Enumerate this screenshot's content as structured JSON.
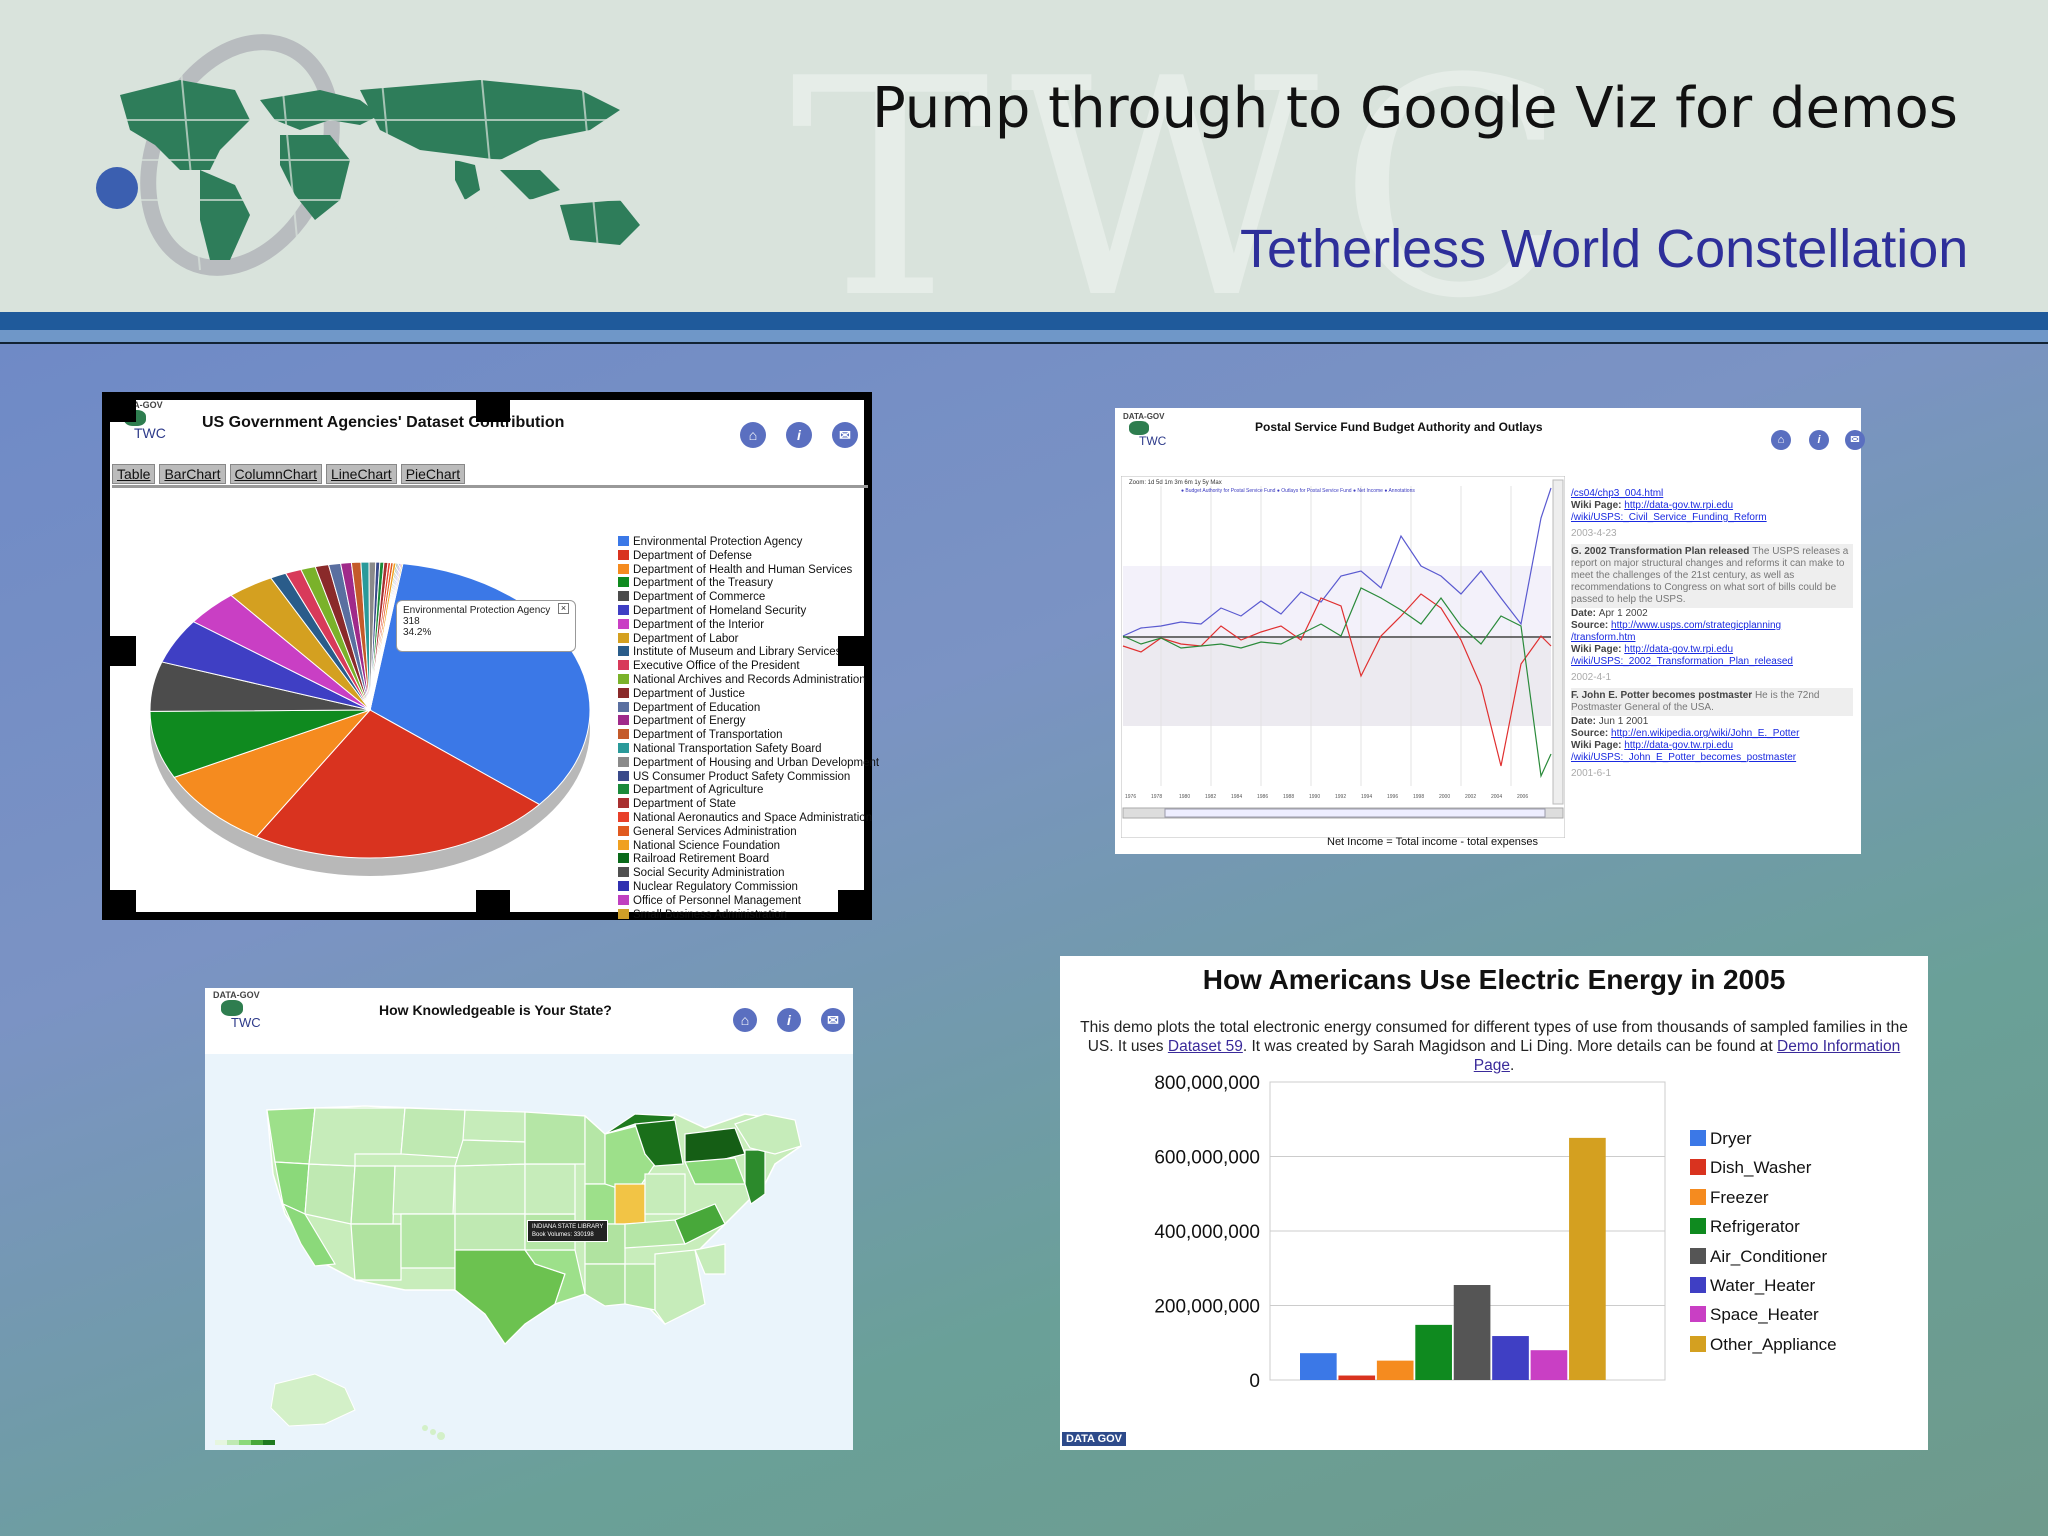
{
  "slide": {
    "title": "Pump through to Google Viz for demos",
    "subtitle": "Tetherless World Constellation",
    "watermark": "TWC"
  },
  "colors": {
    "header_bg": "#d9e3dc",
    "title_blue": "#2e2f9a",
    "bar_blue": "#1f5a9b",
    "map_green": "#2e7d4f"
  },
  "pie_panel": {
    "logo_top": "DATA-GOV",
    "logo_bottom": "TWC",
    "title": "US Government Agencies' Dataset Contribution",
    "tabs": [
      "Table",
      "BarChart",
      "ColumnChart",
      "LineChart",
      "PieChart"
    ],
    "tooltip": {
      "name": "Environmental Protection Agency",
      "value": "318",
      "percent": "34.2%"
    },
    "legend": [
      {
        "label": "Environmental Protection Agency",
        "color": "#3b78e7"
      },
      {
        "label": "Department of Defense",
        "color": "#d9331f"
      },
      {
        "label": "Department of Health and Human Services",
        "color": "#f58b1f"
      },
      {
        "label": "Department of the Treasury",
        "color": "#0f8a1f"
      },
      {
        "label": "Department of Commerce",
        "color": "#4c4c4c"
      },
      {
        "label": "Department of Homeland Security",
        "color": "#3f3fc4"
      },
      {
        "label": "Department of the Interior",
        "color": "#c93fc4"
      },
      {
        "label": "Department of Labor",
        "color": "#d4a020"
      },
      {
        "label": "Institute of Museum and Library Services",
        "color": "#2a5c8a"
      },
      {
        "label": "Executive Office of the President",
        "color": "#d83a5a"
      },
      {
        "label": "National Archives and Records Administration",
        "color": "#7ab22a"
      },
      {
        "label": "Department of Justice",
        "color": "#8a2a2a"
      },
      {
        "label": "Department of Education",
        "color": "#5a6fa0"
      },
      {
        "label": "Department of Energy",
        "color": "#a02a8a"
      },
      {
        "label": "Department of Transportation",
        "color": "#c45a2a"
      },
      {
        "label": "National Transportation Safety Board",
        "color": "#2a9a9a"
      },
      {
        "label": "Department of Housing and Urban Development",
        "color": "#8a8a8a"
      },
      {
        "label": "US Consumer Product Safety Commission",
        "color": "#3a4a8a"
      },
      {
        "label": "Department of Agriculture",
        "color": "#1a8a3a"
      },
      {
        "label": "Department of State",
        "color": "#a83030"
      },
      {
        "label": "National Aeronautics and Space Administration",
        "color": "#e8402a"
      },
      {
        "label": "General Services Administration",
        "color": "#e05a20"
      },
      {
        "label": "National Science Foundation",
        "color": "#f0a020"
      },
      {
        "label": "Railroad Retirement Board",
        "color": "#0a6a1a"
      },
      {
        "label": "Social Security Administration",
        "color": "#505050"
      },
      {
        "label": "Nuclear Regulatory Commission",
        "color": "#3030b0"
      },
      {
        "label": "Office of Personnel Management",
        "color": "#c040c0"
      },
      {
        "label": "Small Business Administration",
        "color": "#d0a028"
      }
    ]
  },
  "postal_panel": {
    "logo_top": "DATA-GOV",
    "logo_bottom": "TWC",
    "title": "Postal Service Fund Budget Authority and Outlays",
    "caption": "Net Income = Total income - total expenses",
    "timeline": [
      {
        "lines": [
          "/cs04/chp3_004.html"
        ],
        "type": "link"
      },
      {
        "label": "Wiki Page:",
        "link": "http://data-gov.tw.rpi.edu",
        "link2": "/wiki/USPS:_Civil_Service_Funding_Reform"
      },
      {
        "date": "2003-4-23"
      },
      {
        "marker": "G",
        "heading": "2002 Transformation Plan released",
        "text": "The USPS releases a report on major structural changes and reforms it can make to meet the challenges of the 21st century, as well as recommendations to Congress on what sort of bills could be passed to help the USPS."
      },
      {
        "label": "Date:",
        "value": "Apr 1 2002"
      },
      {
        "label": "Source:",
        "link": "http://www.usps.com/strategicplanning",
        "link2": "/transform.htm"
      },
      {
        "label": "Wiki Page:",
        "link": "http://data-gov.tw.rpi.edu",
        "link2": "/wiki/USPS:_2002_Transformation_Plan_released"
      },
      {
        "date": "2002-4-1"
      },
      {
        "marker": "F",
        "heading": "John E. Potter becomes postmaster",
        "text": "He is the 72nd Postmaster General of the USA."
      },
      {
        "label": "Date:",
        "value": "Jun 1 2001"
      },
      {
        "label": "Source:",
        "link": "http://en.wikipedia.org/wiki/John_E._Potter"
      },
      {
        "label": "Wiki Page:",
        "link": "http://data-gov.tw.rpi.edu",
        "link2": "/wiki/USPS:_John_E_Potter_becomes_postmaster"
      },
      {
        "date": "2001-6-1"
      }
    ]
  },
  "map_panel": {
    "logo_top": "DATA-GOV",
    "logo_bottom": "TWC",
    "title": "How Knowledgeable is Your State?",
    "tooltip_title": "INDIANA STATE LIBRARY",
    "tooltip_value": "Book Volumes: 330198"
  },
  "bar_panel": {
    "title": "How Americans Use Electric Energy in 2005",
    "desc_before_link1": "This demo plots the total electronic energy consumed for different types of use from thousands of sampled families in the US. It uses ",
    "link1": "Dataset 59",
    "desc_middle": ". It was created by Sarah Magidson and Li Ding. More details can be found at ",
    "link2": "Demo Information Page",
    "desc_end": ".",
    "footer_logo": "DATA GOV"
  },
  "chart_data": {
    "type": "bar",
    "title": "How Americans Use Electric Energy in 2005",
    "categories": [
      "Dryer",
      "Dish_Washer",
      "Freezer",
      "Refrigerator",
      "Air_Conditioner",
      "Water_Heater",
      "Space_Heater",
      "Other_Appliance"
    ],
    "values": [
      72000000,
      12000000,
      52000000,
      148000000,
      255000000,
      118000000,
      80000000,
      650000000
    ],
    "colors": [
      "#3b78e7",
      "#d9331f",
      "#f58b1f",
      "#0f8a1f",
      "#555555",
      "#3f3fc4",
      "#c93fc4",
      "#d4a020"
    ],
    "yticks": [
      "0",
      "200,000,000",
      "400,000,000",
      "600,000,000",
      "800,000,000"
    ],
    "ylim": [
      0,
      800000000
    ],
    "legend": "right",
    "grid": true
  }
}
